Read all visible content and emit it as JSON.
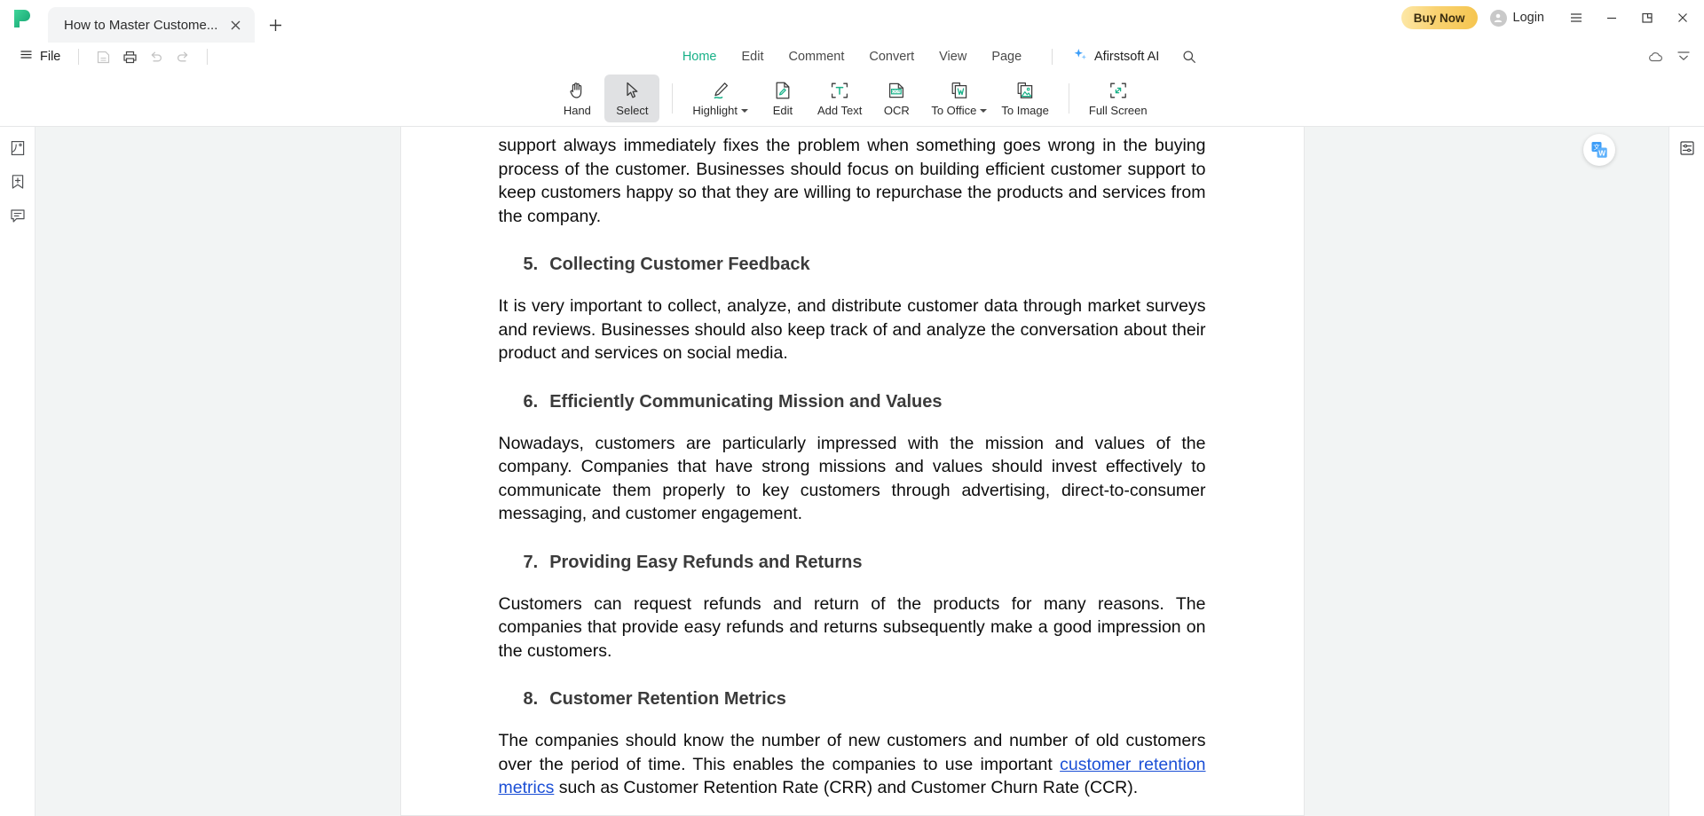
{
  "window": {
    "tab": {
      "title": "How to Master Custome...",
      "close_icon": "close-icon"
    },
    "new_tab_icon": "plus-icon",
    "buy_now_label": "Buy Now",
    "login_label": "Login",
    "menu_icon": "hamburger-menu-icon",
    "minimize_icon": "minimize-icon",
    "maximize_icon": "restore-icon",
    "close_icon": "close-icon"
  },
  "menubar": {
    "file_label": "File",
    "hamburger_icon": "hamburger-icon",
    "quick_actions": [
      {
        "name": "save-icon",
        "label": "Save"
      },
      {
        "name": "print-icon",
        "label": "Print"
      },
      {
        "name": "undo-icon",
        "label": "Undo"
      },
      {
        "name": "redo-icon",
        "label": "Redo"
      }
    ],
    "tabs": [
      {
        "label": "Home",
        "active": true
      },
      {
        "label": "Edit",
        "active": false
      },
      {
        "label": "Comment",
        "active": false
      },
      {
        "label": "Convert",
        "active": false
      },
      {
        "label": "View",
        "active": false
      },
      {
        "label": "Page",
        "active": false
      }
    ],
    "ai_label": "Afirstsoft AI",
    "ai_icon": "sparkle-icon",
    "search_icon": "search-icon",
    "cloud_icon": "cloud-sync-icon",
    "collapse_icon": "collapse-ribbon-icon"
  },
  "ribbon": {
    "items": [
      {
        "label": "Hand",
        "icon": "hand-icon",
        "active": false,
        "dropdown": false
      },
      {
        "label": "Select",
        "icon": "cursor-select-icon",
        "active": true,
        "dropdown": false
      },
      {
        "label": "Highlight",
        "icon": "highlight-pen-icon",
        "active": false,
        "dropdown": true
      },
      {
        "label": "Edit",
        "icon": "edit-document-icon",
        "active": false,
        "dropdown": false
      },
      {
        "label": "Add Text",
        "icon": "add-text-icon",
        "active": false,
        "dropdown": false
      },
      {
        "label": "OCR",
        "icon": "ocr-icon",
        "active": false,
        "dropdown": false
      },
      {
        "label": "To Office",
        "icon": "to-office-icon",
        "active": false,
        "dropdown": true
      },
      {
        "label": "To Image",
        "icon": "to-image-icon",
        "active": false,
        "dropdown": false
      },
      {
        "label": "Full Screen",
        "icon": "full-screen-icon",
        "active": false,
        "dropdown": false
      }
    ]
  },
  "left_rail": {
    "items": [
      {
        "name": "page-thumbnails-icon",
        "label": "Thumbnails"
      },
      {
        "name": "bookmark-add-icon",
        "label": "Bookmarks"
      },
      {
        "name": "comment-list-icon",
        "label": "Comments"
      }
    ]
  },
  "right_rail": {
    "items": [
      {
        "name": "properties-panel-icon",
        "label": "Properties"
      }
    ],
    "floating": {
      "name": "translate-to-word-icon",
      "label": "Translate"
    }
  },
  "document": {
    "blocks": [
      {
        "type": "paragraph",
        "text": "support always immediately fixes the problem when something goes wrong in the buying process of the customer. Businesses should focus on building efficient customer support to keep customers happy so that they are willing to repurchase the products and services from the company."
      },
      {
        "type": "heading",
        "number": "5.",
        "text": "Collecting Customer Feedback"
      },
      {
        "type": "paragraph",
        "text": "It is very important to collect, analyze, and distribute customer data through market surveys and reviews. Businesses should also keep track of and analyze the conversation about their product and services on social media."
      },
      {
        "type": "heading",
        "number": "6.",
        "text": "Efficiently Communicating Mission and Values"
      },
      {
        "type": "paragraph",
        "text": "Nowadays, customers are particularly impressed with the mission and values of the company. Companies that have strong missions and values should invest effectively to communicate them properly to key customers through advertising, direct-to-consumer messaging, and customer engagement."
      },
      {
        "type": "heading",
        "number": "7.",
        "text": "Providing Easy Refunds and Returns"
      },
      {
        "type": "paragraph",
        "text": "Customers can request refunds and return of the products for many reasons. The companies that provide easy refunds and returns subsequently make a good impression on the customers."
      },
      {
        "type": "heading",
        "number": "8.",
        "text": "Customer Retention Metrics"
      },
      {
        "type": "paragraph-with-link",
        "text_before": "The companies should know the number of new customers and number of old customers over the period of time. This enables the companies to use important ",
        "link_text": "customer retention metrics",
        "text_after": " such as Customer Retention Rate (CRR) and Customer Churn Rate (CCR)."
      }
    ]
  },
  "colors": {
    "accent_green": "#18b188",
    "buy_now_gold": "#f5c54f",
    "link_blue": "#1b4fd6",
    "workspace_bg": "#f2f4f4"
  }
}
